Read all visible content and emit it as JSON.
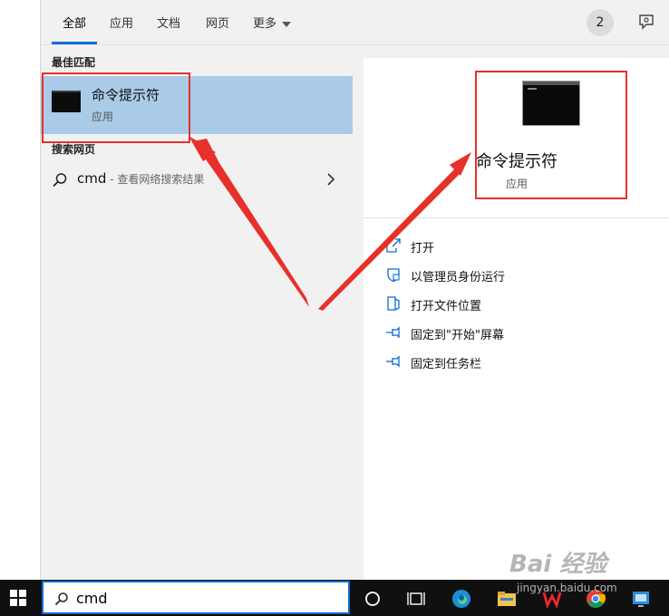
{
  "tabs": {
    "all": "全部",
    "apps": "应用",
    "documents": "文档",
    "web": "网页",
    "more": "更多"
  },
  "rewards_count": "2",
  "sections": {
    "best_match": "最佳匹配",
    "search_web": "搜索网页"
  },
  "best_match": {
    "title": "命令提示符",
    "subtitle": "应用"
  },
  "web_result": {
    "query": "cmd",
    "description": " - 查看网络搜索结果"
  },
  "detail": {
    "title": "命令提示符",
    "subtitle": "应用"
  },
  "actions": [
    {
      "label": "打开",
      "icon": "open-icon"
    },
    {
      "label": "以管理员身份运行",
      "icon": "shield-icon"
    },
    {
      "label": "打开文件位置",
      "icon": "file-location-icon"
    },
    {
      "label": "固定到\"开始\"屏幕",
      "icon": "pin-icon"
    },
    {
      "label": "固定到任务栏",
      "icon": "pin-icon"
    }
  ],
  "taskbar": {
    "search_value": "cmd"
  },
  "watermark": {
    "logo": "Bai 经验",
    "url": "jingyan.baidu.com"
  },
  "colors": {
    "accent": "#0a6ed1",
    "selection": "#a9cbe8",
    "annotation": "#e8302a"
  }
}
